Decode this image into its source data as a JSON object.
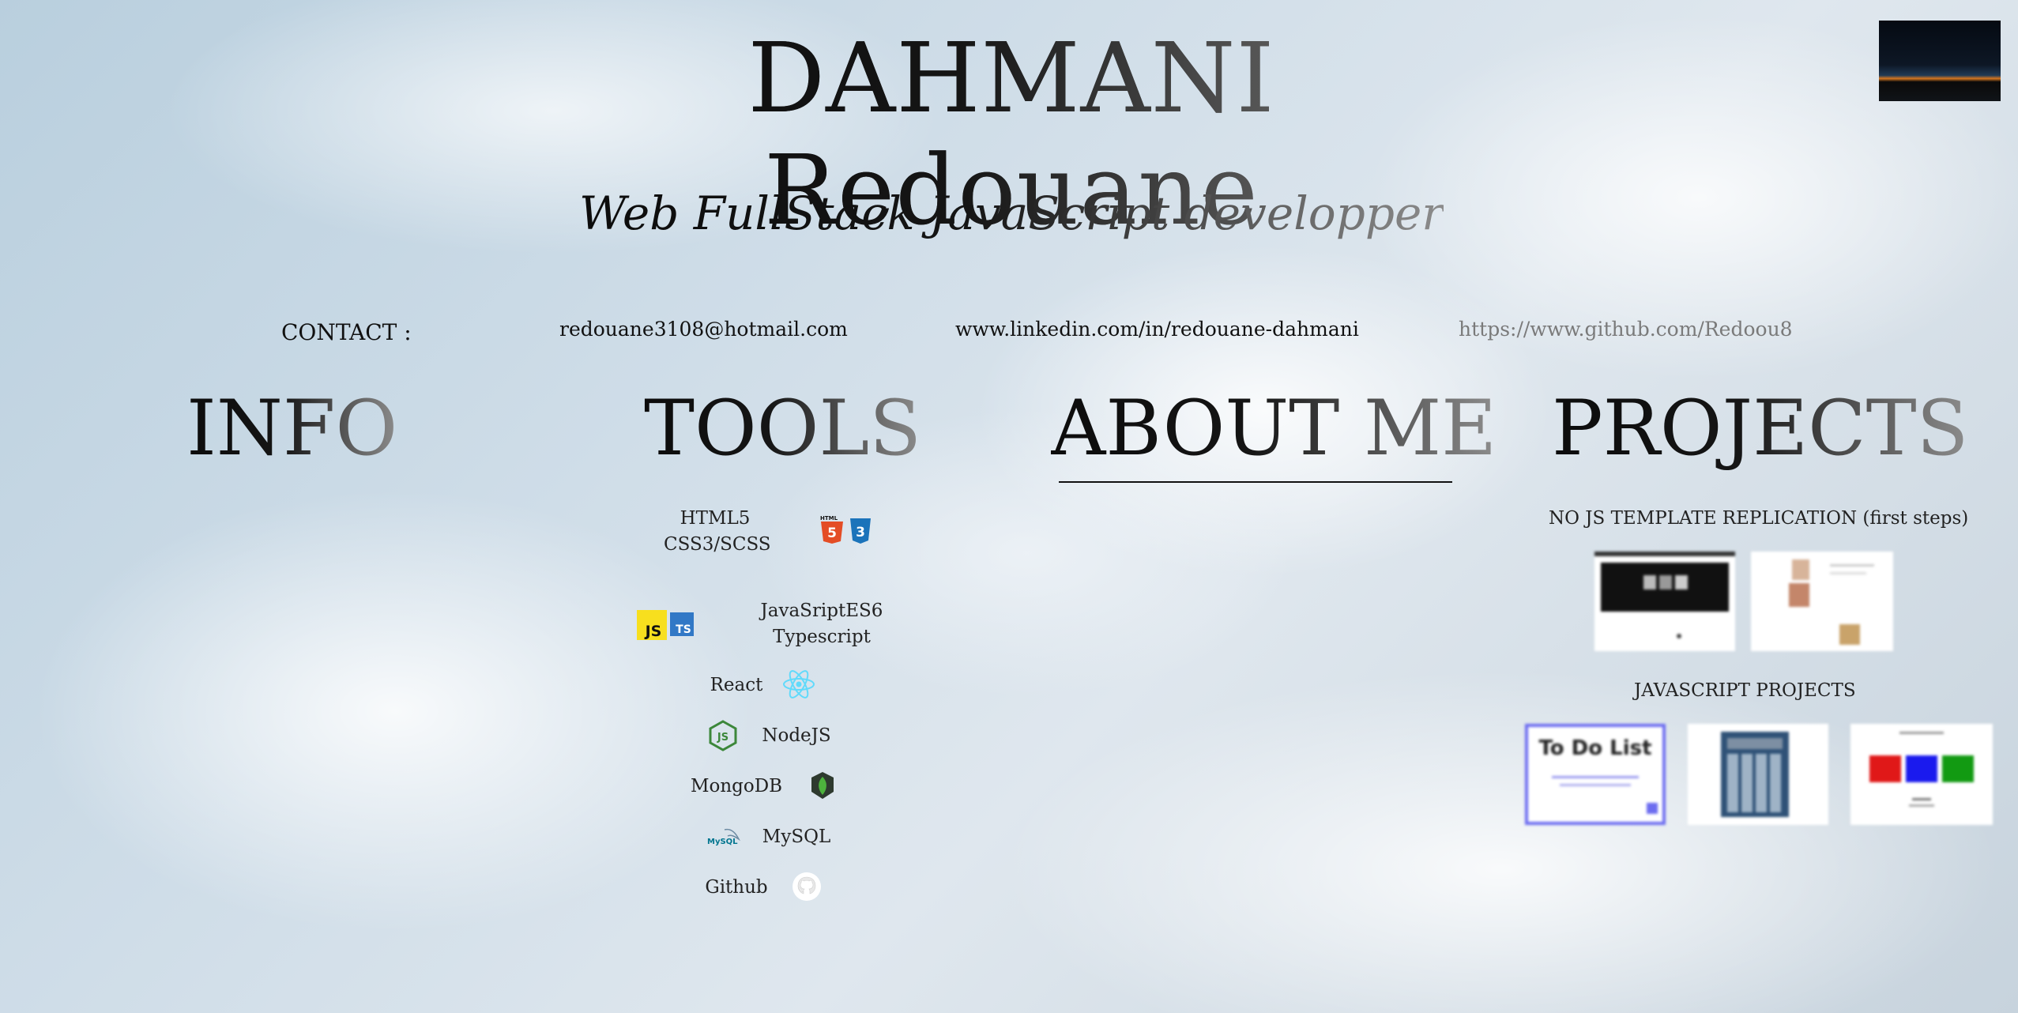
{
  "header": {
    "title": "DAHMANI Redouane",
    "subtitle": "Web FullStack JavaScript developper"
  },
  "contact": {
    "label": "CONTACT :",
    "email": "redouane3108@hotmail.com",
    "linkedin": "www.linkedin.com/in/redouane-dahmani",
    "github": "https://www.github.com/Redoou8"
  },
  "sections": {
    "info": "INFO",
    "tools": "TOOLS",
    "about": "ABOUT ME",
    "projects": "PROJECTS"
  },
  "tools": {
    "html_css": [
      "HTML5",
      "CSS3/SCSS"
    ],
    "js_ts": [
      "JavaSriptES6",
      "Typescript"
    ],
    "react": "React",
    "node": "NodeJS",
    "mongo": "MongoDB",
    "mysql": "MySQL",
    "github": "Github",
    "icons": {
      "html5": "HTML",
      "js": "JS",
      "ts": "TS",
      "node": "JS",
      "mysql": "MySQL"
    }
  },
  "projects": {
    "no_js_heading": "NO JS TEMPLATE REPLICATION (first steps)",
    "js_heading": "JAVASCRIPT PROJECTS",
    "todo_thumb_text": "To Do List"
  },
  "colors": {
    "html5": "#e44d26",
    "css3": "#1b73ba",
    "js": "#f7df1e",
    "ts": "#3178c6",
    "react": "#61dafb",
    "node": "#3c873a",
    "mongo": "#4db33d",
    "github_link": "#7a7a7a"
  }
}
